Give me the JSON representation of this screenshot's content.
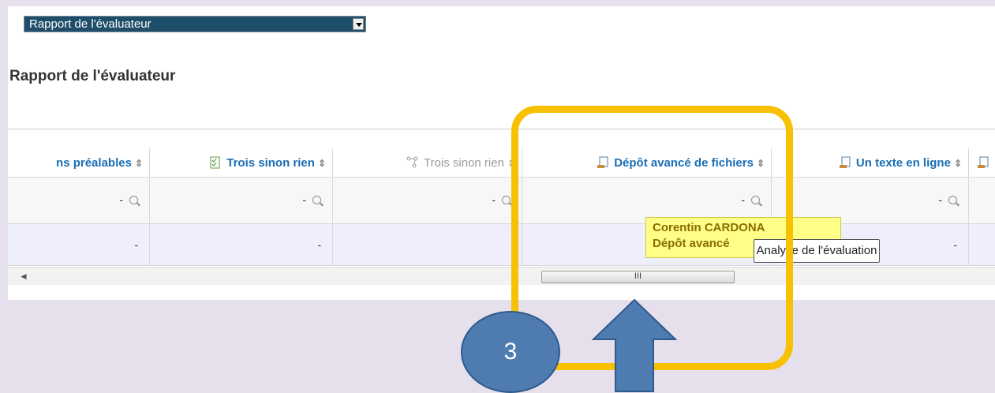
{
  "top": {
    "report_select_value": "Rapport de l'évaluateur",
    "page_heading": "Rapport de l'évaluateur"
  },
  "table": {
    "columns": [
      {
        "label": "ns préalables",
        "style": "link"
      },
      {
        "label": "Trois sinon rien",
        "style": "link"
      },
      {
        "label": "Trois sinon rien",
        "style": "disabled"
      },
      {
        "label": "Dépôt avancé de fichiers",
        "style": "link"
      },
      {
        "label": "Un texte en ligne",
        "style": "link"
      }
    ],
    "sort_glyph": "⇕",
    "filter_value": "-",
    "row_value": "-"
  },
  "tooltip": {
    "name": "Corentin CARDONA",
    "detail": "Dépôt avancé",
    "action": "Analyse de l'évaluation"
  },
  "scrollbar": {
    "left_arrow": "◄",
    "grip": "III"
  },
  "annotation": {
    "step_number": "3"
  },
  "colors": {
    "link": "#1a6eb5",
    "highlight": "#f7c000",
    "badge": "#4e7bb0",
    "tooltip_bg": "#ffff88"
  }
}
